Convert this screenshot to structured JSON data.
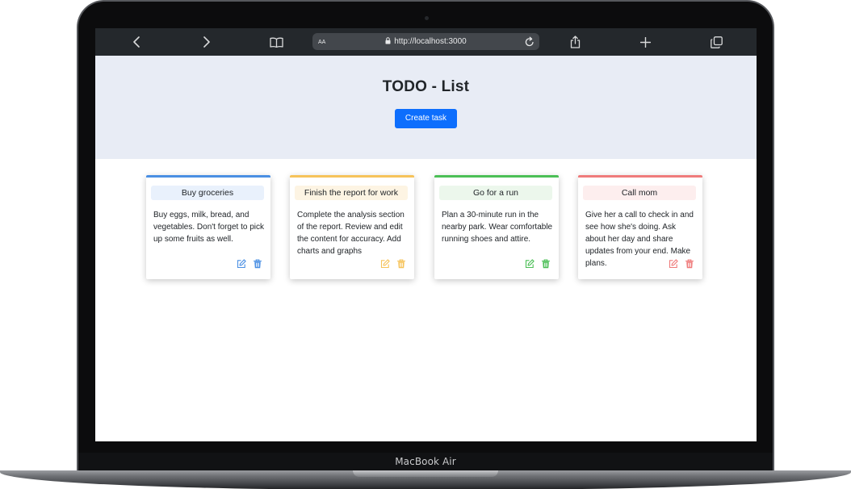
{
  "device": {
    "label": "MacBook Air"
  },
  "browser": {
    "text_size_label": "AA",
    "url": "http://localhost:3000",
    "icons": [
      "chevron-left-icon",
      "chevron-right-icon",
      "book-icon",
      "lock-icon",
      "reload-icon",
      "share-icon",
      "plus-icon",
      "tabs-icon"
    ],
    "bar_color": "#24282c"
  },
  "page": {
    "title": "TODO - List",
    "create_button": "Create task",
    "hero_color": "#e8ecf5",
    "button_color": "#0d6efd"
  },
  "cards": [
    {
      "title": "Buy groceries",
      "body": "Buy eggs, milk, bread, and vegetables. Don't forget to pick up some fruits as well.",
      "color": "#4a8fe3",
      "tint": "#e9f1fc"
    },
    {
      "title": "Finish the report for work",
      "body": "Complete the analysis section of the report. Review and edit the content for accuracy. Add charts and graphs",
      "color": "#f6c35a",
      "tint": "#fdf4e3"
    },
    {
      "title": "Go for a run",
      "body": "Plan a 30-minute run in the nearby park. Wear comfortable running shoes and attire.",
      "color": "#4bbf56",
      "tint": "#ecf7ec"
    },
    {
      "title": "Call mom",
      "body": "Give her a call to check in and see how she's doing. Ask about her day and share updates from your end. Make plans.",
      "color": "#ef7b7b",
      "tint": "#fdeeee"
    }
  ]
}
